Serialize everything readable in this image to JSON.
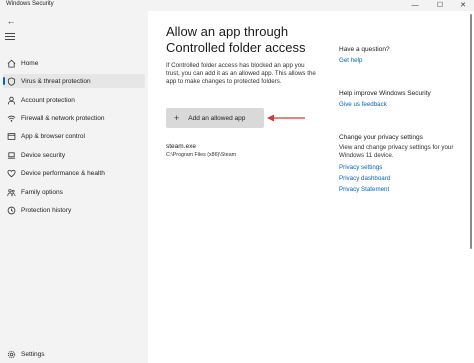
{
  "window": {
    "title": "Windows Security",
    "minimize_icon": "minimize-icon",
    "maximize_icon": "maximize-icon",
    "close_icon": "close-icon"
  },
  "sidebar": {
    "back_icon": "back-arrow-icon",
    "menu_icon": "hamburger-menu-icon",
    "items": [
      {
        "label": "Home",
        "icon": "home-icon"
      },
      {
        "label": "Virus & threat protection",
        "icon": "shield-icon",
        "active": true
      },
      {
        "label": "Account protection",
        "icon": "person-icon"
      },
      {
        "label": "Firewall & network protection",
        "icon": "wifi-icon"
      },
      {
        "label": "App & browser control",
        "icon": "app-window-icon"
      },
      {
        "label": "Device security",
        "icon": "laptop-icon"
      },
      {
        "label": "Device performance & health",
        "icon": "heart-icon"
      },
      {
        "label": "Family options",
        "icon": "family-icon"
      },
      {
        "label": "Protection history",
        "icon": "history-icon"
      }
    ],
    "settings": {
      "label": "Settings",
      "icon": "gear-icon"
    }
  },
  "main": {
    "title_line1": "Allow an app through",
    "title_line2": "Controlled folder access",
    "description": "If Controlled folder access has blocked an app you trust, you can add it as an allowed app. This allows the app to make changes to protected folders.",
    "add_button": {
      "label": "Add an allowed app",
      "icon": "plus-icon"
    },
    "apps": [
      {
        "name": "steam.exe",
        "path": "C:\\Program Files (x86)\\Steam"
      }
    ]
  },
  "aside": {
    "question": {
      "heading": "Have a question?",
      "link": "Get help"
    },
    "improve": {
      "heading": "Help improve Windows Security",
      "link": "Give us feedback"
    },
    "privacy": {
      "heading": "Change your privacy settings",
      "text": "View and change privacy settings for your Windows 11 device.",
      "links": [
        "Privacy settings",
        "Privacy dashboard",
        "Privacy Statement"
      ]
    }
  },
  "colors": {
    "accent": "#0067c0",
    "annotation": "#d93636"
  }
}
